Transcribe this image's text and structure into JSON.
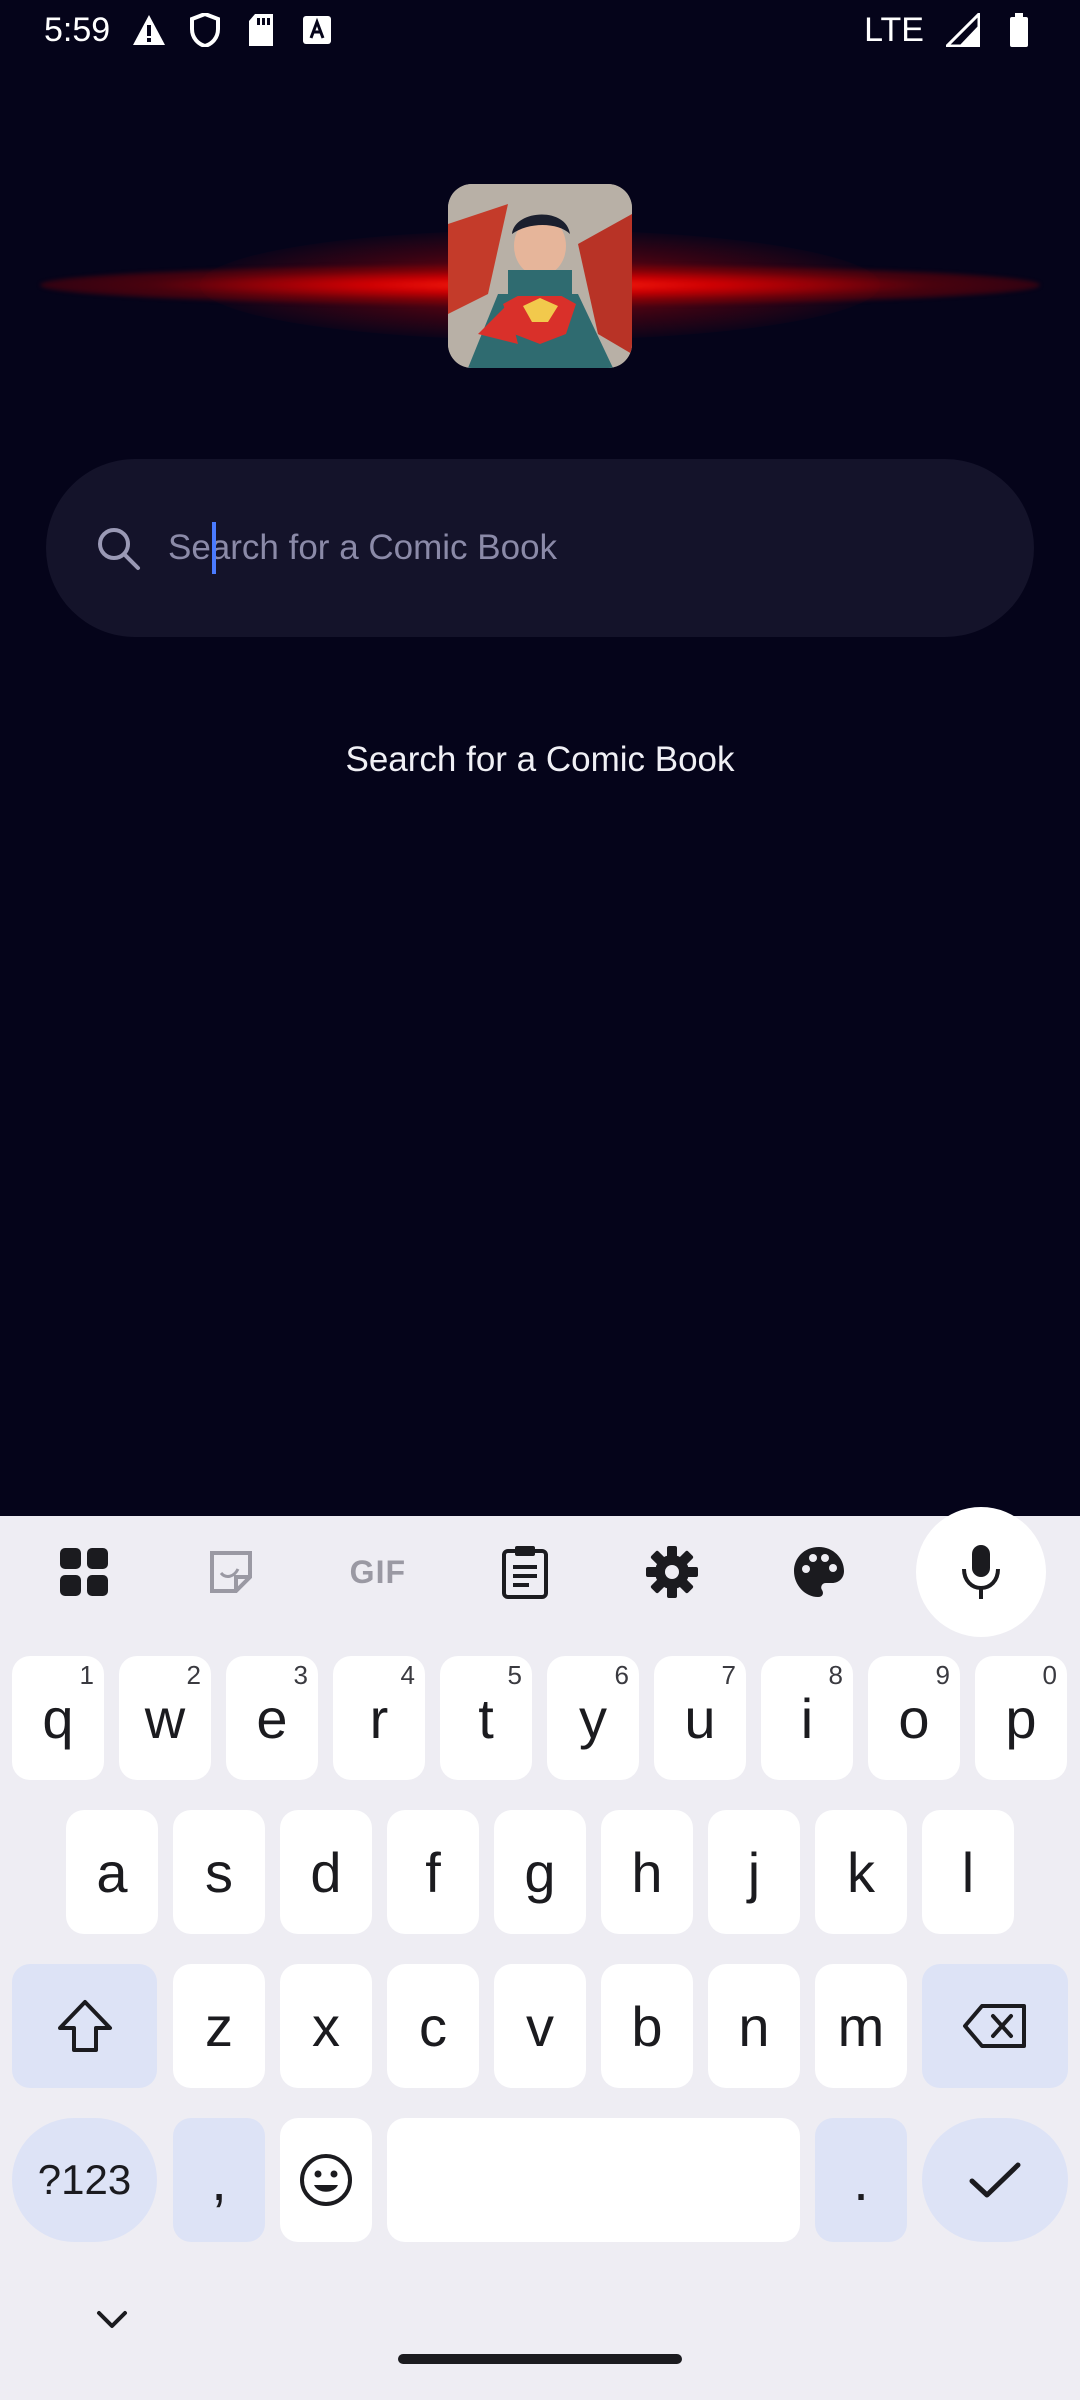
{
  "status_bar": {
    "time": "5:59",
    "network": "LTE"
  },
  "search": {
    "placeholder": "Search for a Comic Book",
    "value": ""
  },
  "empty_message": "Search for a Comic Book",
  "keyboard": {
    "toolbar": {
      "items": [
        "apps-grid-icon",
        "sticker-icon",
        "GIF",
        "clipboard-icon",
        "settings-icon",
        "palette-icon",
        "microphone-icon"
      ],
      "gif_label": "GIF"
    },
    "row1": [
      {
        "key": "q",
        "hint": "1"
      },
      {
        "key": "w",
        "hint": "2"
      },
      {
        "key": "e",
        "hint": "3"
      },
      {
        "key": "r",
        "hint": "4"
      },
      {
        "key": "t",
        "hint": "5"
      },
      {
        "key": "y",
        "hint": "6"
      },
      {
        "key": "u",
        "hint": "7"
      },
      {
        "key": "i",
        "hint": "8"
      },
      {
        "key": "o",
        "hint": "9"
      },
      {
        "key": "p",
        "hint": "0"
      }
    ],
    "row2": [
      "a",
      "s",
      "d",
      "f",
      "g",
      "h",
      "j",
      "k",
      "l"
    ],
    "row3": [
      "z",
      "x",
      "c",
      "v",
      "b",
      "n",
      "m"
    ],
    "row4": {
      "symbols_label": "?123",
      "comma_label": ",",
      "period_label": "."
    }
  },
  "colors": {
    "background": "#05041a",
    "search_field": "#14132a",
    "glow": "#ff1a0a",
    "accent_caret": "#4a7bff",
    "function_key": "#dde3f6"
  }
}
